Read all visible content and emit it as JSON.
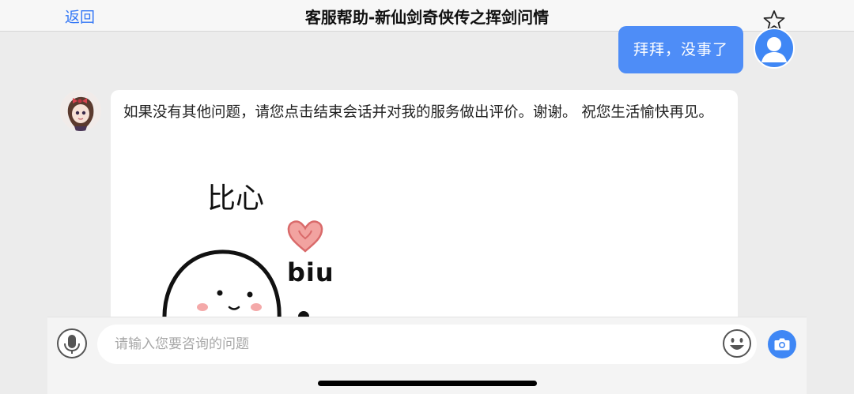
{
  "header": {
    "back_label": "返回",
    "title": "客服帮助-新仙剑奇侠传之挥剑问情",
    "favorite_icon": "star-icon"
  },
  "messages": [
    {
      "sender": "user",
      "text": "拜拜，没事了",
      "avatar_icon": "user-icon"
    },
    {
      "sender": "agent",
      "text": "如果没有其他问题，请您点击结束会话并对我的服务做出评价。谢谢。 祝您生活愉快再见。",
      "sticker": {
        "caption": "比心",
        "sound": "biu",
        "heart_icon": "heart-icon"
      }
    }
  ],
  "composer": {
    "placeholder": "请输入您要咨询的问题",
    "value": "",
    "mic_icon": "microphone-icon",
    "emoji_icon": "smiley-icon",
    "camera_icon": "camera-icon"
  },
  "colors": {
    "accent": "#3f87f5",
    "user_bubble": "#4e8df7",
    "background": "#ececec"
  }
}
